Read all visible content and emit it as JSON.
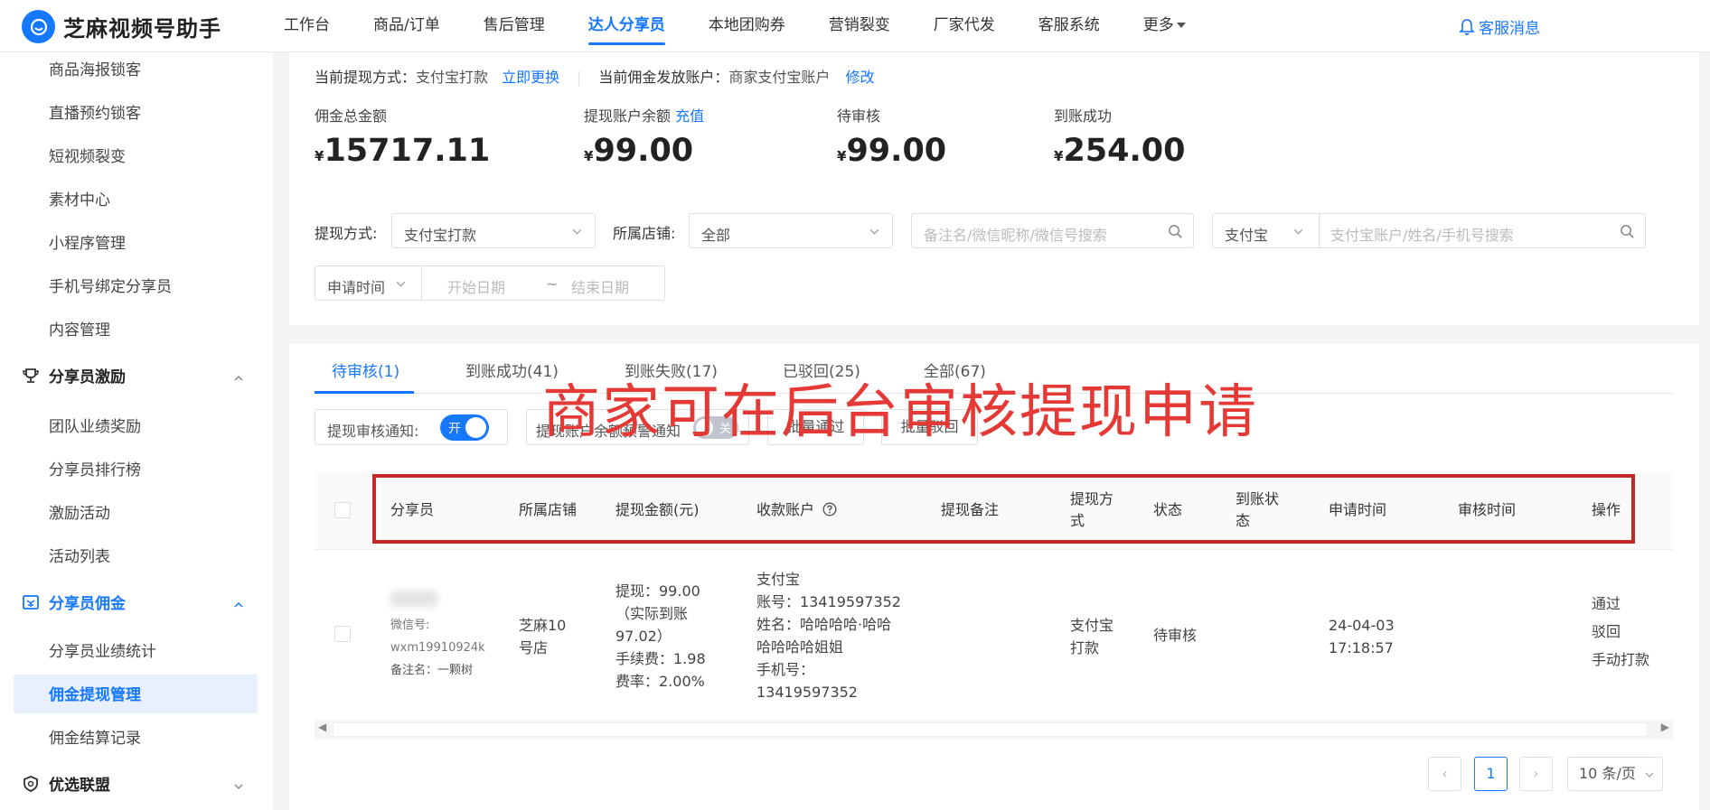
{
  "app": {
    "name": "芝麻视频号助手"
  },
  "nav": {
    "items": [
      "工作台",
      "商品/订单",
      "售后管理",
      "达人分享员",
      "本地团购券",
      "营销裂变",
      "厂家代发",
      "客服系统",
      "更多"
    ],
    "active_index": 3,
    "service_msg": "客服消息"
  },
  "sidebar": {
    "items_top": [
      "商品海报锁客",
      "直播预约锁客",
      "短视频裂变",
      "素材中心",
      "小程序管理",
      "手机号绑定分享员",
      "内容管理"
    ],
    "group_incentive": "分享员激励",
    "items_incentive": [
      "团队业绩奖励",
      "分享员排行榜",
      "激励活动",
      "活动列表"
    ],
    "group_commission": "分享员佣金",
    "items_commission": [
      "分享员业绩统计",
      "佣金提现管理",
      "佣金结算记录"
    ],
    "group_alliance": "优选联盟"
  },
  "info": {
    "withdraw_method_label": "当前提现方式：",
    "withdraw_method_value": "支付宝打款",
    "change_link": "立即更换",
    "account_label": "当前佣金发放账户：",
    "account_value": "商家支付宝账户",
    "modify_link": "修改"
  },
  "stats": {
    "currency": "¥",
    "total_label": "佣金总金额",
    "total_value": "15717.11",
    "balance_label": "提现账户余额",
    "recharge_link": "充值",
    "balance_value": "99.00",
    "pending_label": "待审核",
    "pending_value": "99.00",
    "success_label": "到账成功",
    "success_value": "254.00"
  },
  "filters": {
    "method_label": "提现方式:",
    "method_value": "支付宝打款",
    "store_label": "所属店铺:",
    "store_value": "全部",
    "search_placeholder": "备注名/微信昵称/微信号搜索",
    "pay_type_value": "支付宝",
    "pay_search_placeholder": "支付宝账户/姓名/手机号搜索",
    "date_type_value": "申请时间",
    "start_placeholder": "开始日期",
    "date_sep": "~",
    "end_placeholder": "结束日期"
  },
  "tabs": [
    "待审核(1)",
    "到账成功(41)",
    "到账失败(17)",
    "已驳回(25)",
    "全部(67)"
  ],
  "toolbar": {
    "notify_label": "提现审核通知:",
    "notify_switch": "开",
    "balance_notify_label": "提现账户余额预警通知",
    "balance_switch": "关",
    "batch_pass": "批量通过",
    "batch_reject": "批量驳回"
  },
  "overlay_text": "商家可在后台审核提现申请",
  "table": {
    "headers": {
      "sharer": "分享员",
      "store": "所属店铺",
      "amount": "提现金额(元)",
      "account": "收款账户",
      "note": "提现备注",
      "method_l1": "提现方",
      "method_l2": "式",
      "status": "状态",
      "arrival_l1": "到账状",
      "arrival_l2": "态",
      "apply_time": "申请时间",
      "review_time": "审核时间",
      "action": "操作"
    },
    "row": {
      "wechat_label": "微信号:",
      "wechat_id": "wxm19910924k",
      "remark": "备注名：一颗树",
      "store_l1": "芝麻10",
      "store_l2": "号店",
      "amount_l1": "提现：99.00",
      "amount_l2": "（实际到账",
      "amount_l3": "97.02）",
      "amount_l4": "手续费：1.98",
      "amount_l5": "费率：2.00%",
      "acc_l1": "支付宝",
      "acc_l2": "账号：13419597352",
      "acc_l3": "姓名：哈哈哈哈·哈哈",
      "acc_l4": "哈哈哈哈姐姐",
      "acc_l5": "手机号：",
      "acc_l6": "13419597352",
      "method_l1": "支付宝",
      "method_l2": "打款",
      "status": "待审核",
      "apply_date": "24-04-03",
      "apply_time": "17:18:57",
      "action_pass": "通过",
      "action_reject": "驳回",
      "action_manual": "手动打款"
    }
  },
  "pagination": {
    "current": "1",
    "page_size": "10 条/页"
  }
}
